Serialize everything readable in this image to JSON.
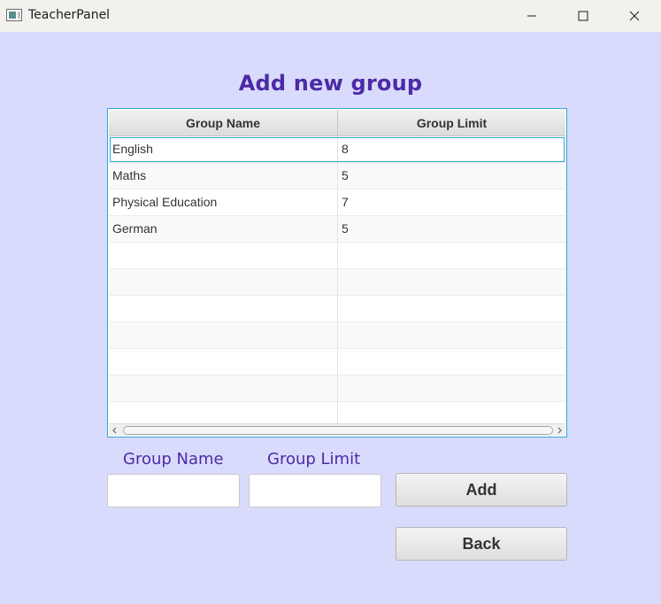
{
  "window": {
    "title": "TeacherPanel",
    "icon": "app-window-icon",
    "controls": [
      "minimize-icon",
      "maximize-icon",
      "close-icon"
    ]
  },
  "heading": "Add new group",
  "table": {
    "columns": [
      "Group Name",
      "Group Limit"
    ],
    "rows": [
      {
        "name": "English",
        "limit": "8"
      },
      {
        "name": "Maths",
        "limit": "5"
      },
      {
        "name": "Physical Education",
        "limit": "7"
      },
      {
        "name": "German",
        "limit": "5"
      },
      {
        "name": "",
        "limit": ""
      },
      {
        "name": "",
        "limit": ""
      },
      {
        "name": "",
        "limit": ""
      },
      {
        "name": "",
        "limit": ""
      },
      {
        "name": "",
        "limit": ""
      },
      {
        "name": "",
        "limit": ""
      },
      {
        "name": "",
        "limit": ""
      }
    ],
    "selected_row": 0
  },
  "form": {
    "name_label": "Group Name",
    "limit_label": "Group Limit",
    "name_value": "",
    "limit_value": "",
    "add_label": "Add",
    "back_label": "Back"
  },
  "colors": {
    "background": "#d9dbfc",
    "accent_text": "#4d2aa6",
    "table_border": "#2ea8d6"
  }
}
